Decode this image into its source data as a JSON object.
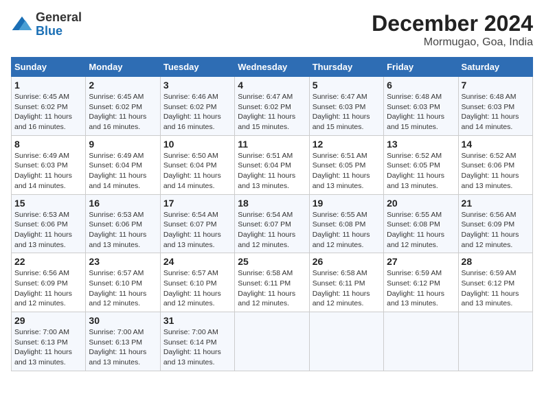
{
  "header": {
    "logo_general": "General",
    "logo_blue": "Blue",
    "title": "December 2024",
    "subtitle": "Mormugao, Goa, India"
  },
  "days_of_week": [
    "Sunday",
    "Monday",
    "Tuesday",
    "Wednesday",
    "Thursday",
    "Friday",
    "Saturday"
  ],
  "weeks": [
    [
      {
        "day": "1",
        "sunrise": "6:45 AM",
        "sunset": "6:02 PM",
        "daylight": "11 hours and 16 minutes."
      },
      {
        "day": "2",
        "sunrise": "6:45 AM",
        "sunset": "6:02 PM",
        "daylight": "11 hours and 16 minutes."
      },
      {
        "day": "3",
        "sunrise": "6:46 AM",
        "sunset": "6:02 PM",
        "daylight": "11 hours and 16 minutes."
      },
      {
        "day": "4",
        "sunrise": "6:47 AM",
        "sunset": "6:02 PM",
        "daylight": "11 hours and 15 minutes."
      },
      {
        "day": "5",
        "sunrise": "6:47 AM",
        "sunset": "6:03 PM",
        "daylight": "11 hours and 15 minutes."
      },
      {
        "day": "6",
        "sunrise": "6:48 AM",
        "sunset": "6:03 PM",
        "daylight": "11 hours and 15 minutes."
      },
      {
        "day": "7",
        "sunrise": "6:48 AM",
        "sunset": "6:03 PM",
        "daylight": "11 hours and 14 minutes."
      }
    ],
    [
      {
        "day": "8",
        "sunrise": "6:49 AM",
        "sunset": "6:03 PM",
        "daylight": "11 hours and 14 minutes."
      },
      {
        "day": "9",
        "sunrise": "6:49 AM",
        "sunset": "6:04 PM",
        "daylight": "11 hours and 14 minutes."
      },
      {
        "day": "10",
        "sunrise": "6:50 AM",
        "sunset": "6:04 PM",
        "daylight": "11 hours and 14 minutes."
      },
      {
        "day": "11",
        "sunrise": "6:51 AM",
        "sunset": "6:04 PM",
        "daylight": "11 hours and 13 minutes."
      },
      {
        "day": "12",
        "sunrise": "6:51 AM",
        "sunset": "6:05 PM",
        "daylight": "11 hours and 13 minutes."
      },
      {
        "day": "13",
        "sunrise": "6:52 AM",
        "sunset": "6:05 PM",
        "daylight": "11 hours and 13 minutes."
      },
      {
        "day": "14",
        "sunrise": "6:52 AM",
        "sunset": "6:06 PM",
        "daylight": "11 hours and 13 minutes."
      }
    ],
    [
      {
        "day": "15",
        "sunrise": "6:53 AM",
        "sunset": "6:06 PM",
        "daylight": "11 hours and 13 minutes."
      },
      {
        "day": "16",
        "sunrise": "6:53 AM",
        "sunset": "6:06 PM",
        "daylight": "11 hours and 13 minutes."
      },
      {
        "day": "17",
        "sunrise": "6:54 AM",
        "sunset": "6:07 PM",
        "daylight": "11 hours and 13 minutes."
      },
      {
        "day": "18",
        "sunrise": "6:54 AM",
        "sunset": "6:07 PM",
        "daylight": "11 hours and 12 minutes."
      },
      {
        "day": "19",
        "sunrise": "6:55 AM",
        "sunset": "6:08 PM",
        "daylight": "11 hours and 12 minutes."
      },
      {
        "day": "20",
        "sunrise": "6:55 AM",
        "sunset": "6:08 PM",
        "daylight": "11 hours and 12 minutes."
      },
      {
        "day": "21",
        "sunrise": "6:56 AM",
        "sunset": "6:09 PM",
        "daylight": "11 hours and 12 minutes."
      }
    ],
    [
      {
        "day": "22",
        "sunrise": "6:56 AM",
        "sunset": "6:09 PM",
        "daylight": "11 hours and 12 minutes."
      },
      {
        "day": "23",
        "sunrise": "6:57 AM",
        "sunset": "6:10 PM",
        "daylight": "11 hours and 12 minutes."
      },
      {
        "day": "24",
        "sunrise": "6:57 AM",
        "sunset": "6:10 PM",
        "daylight": "11 hours and 12 minutes."
      },
      {
        "day": "25",
        "sunrise": "6:58 AM",
        "sunset": "6:11 PM",
        "daylight": "11 hours and 12 minutes."
      },
      {
        "day": "26",
        "sunrise": "6:58 AM",
        "sunset": "6:11 PM",
        "daylight": "11 hours and 12 minutes."
      },
      {
        "day": "27",
        "sunrise": "6:59 AM",
        "sunset": "6:12 PM",
        "daylight": "11 hours and 13 minutes."
      },
      {
        "day": "28",
        "sunrise": "6:59 AM",
        "sunset": "6:12 PM",
        "daylight": "11 hours and 13 minutes."
      }
    ],
    [
      {
        "day": "29",
        "sunrise": "7:00 AM",
        "sunset": "6:13 PM",
        "daylight": "11 hours and 13 minutes."
      },
      {
        "day": "30",
        "sunrise": "7:00 AM",
        "sunset": "6:13 PM",
        "daylight": "11 hours and 13 minutes."
      },
      {
        "day": "31",
        "sunrise": "7:00 AM",
        "sunset": "6:14 PM",
        "daylight": "11 hours and 13 minutes."
      },
      null,
      null,
      null,
      null
    ]
  ],
  "labels": {
    "sunrise": "Sunrise:",
    "sunset": "Sunset:",
    "daylight": "Daylight:"
  }
}
